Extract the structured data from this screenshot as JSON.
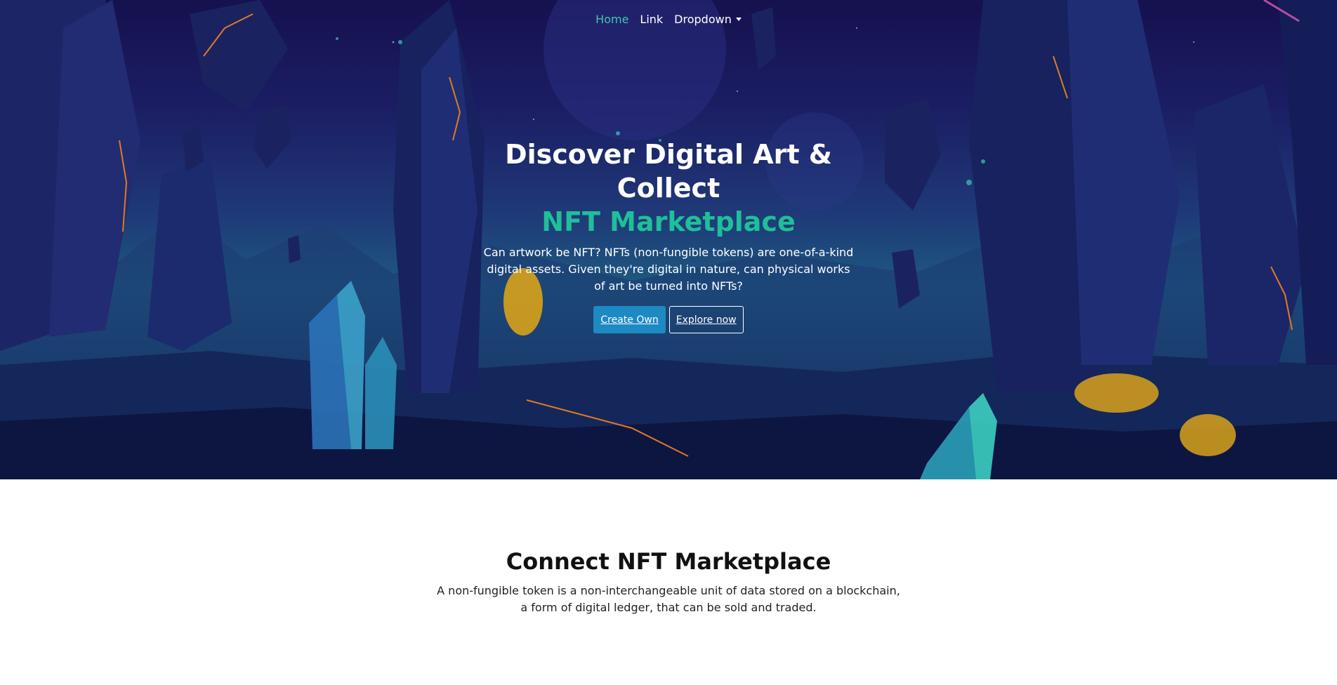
{
  "nav": {
    "items": [
      {
        "label": "Home",
        "active": true
      },
      {
        "label": "Link",
        "active": false
      },
      {
        "label": "Dropdown",
        "active": false
      }
    ]
  },
  "hero": {
    "title": "Discover Digital Art & Collect",
    "accent": "NFT Marketplace",
    "text": "Can artwork be NFT? NFTs (non-fungible tokens) are one-of-a-kind digital assets. Given they're digital in nature, can physical works of art be turned into NFTs?",
    "primary_button": "Create Own",
    "secondary_button": "Explore now"
  },
  "connect": {
    "title": "Connect NFT Marketplace",
    "text": "A non-fungible token is a non-interchangeable unit of data stored on a blockchain, a form of digital ledger, that can be sold and traded."
  },
  "colors": {
    "accent": "#1fbf99",
    "nav_active": "#3bc9b0",
    "primary_button": "#1e8ac3",
    "hero_bg": "#1b1d63"
  }
}
